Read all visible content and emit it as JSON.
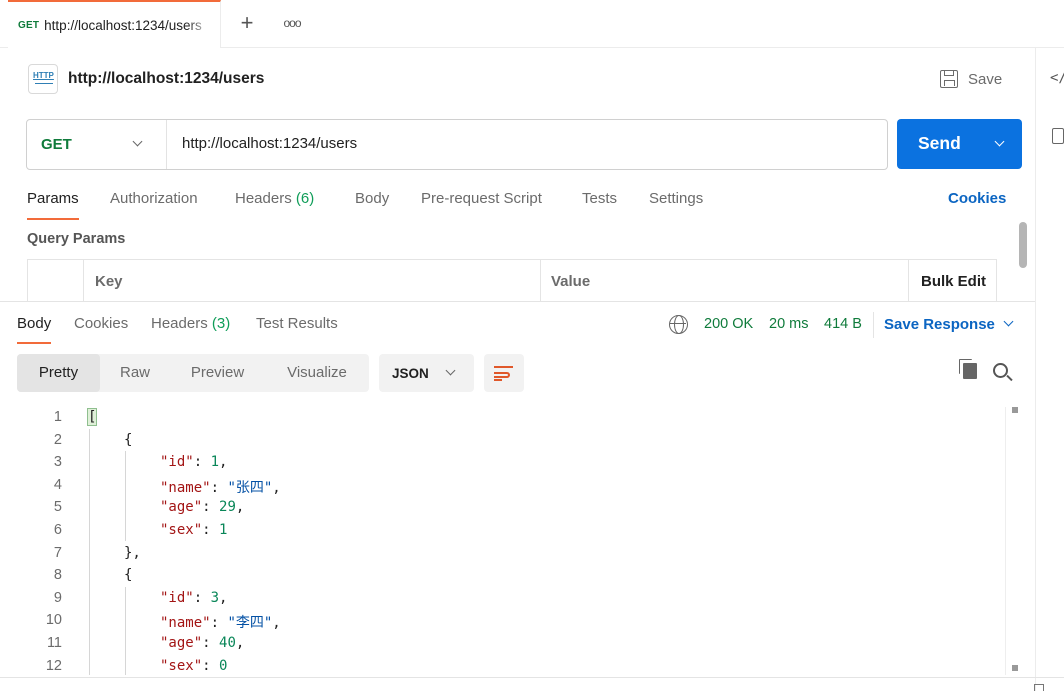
{
  "tabbar": {
    "tab_method": "GET",
    "tab_url": "http://localhost:1234/users",
    "new_tab": "+",
    "more": "ooo"
  },
  "sidebar_right": {
    "code_icon": "</"
  },
  "request": {
    "title": "http://localhost:1234/users",
    "save_label": "Save",
    "method": "GET",
    "url": "http://localhost:1234/users",
    "send_label": "Send"
  },
  "request_tabs": [
    {
      "label": "Params",
      "active": true
    },
    {
      "label": "Authorization"
    },
    {
      "label": "Headers",
      "count": "(6)"
    },
    {
      "label": "Body"
    },
    {
      "label": "Pre-request Script"
    },
    {
      "label": "Tests"
    },
    {
      "label": "Settings"
    }
  ],
  "cookies_label": "Cookies",
  "query_params": {
    "title": "Query Params",
    "columns": [
      "Key",
      "Value",
      "Bulk Edit"
    ]
  },
  "response": {
    "tabs": [
      {
        "label": "Body",
        "active": true
      },
      {
        "label": "Cookies"
      },
      {
        "label": "Headers",
        "count": "(3)"
      },
      {
        "label": "Test Results"
      }
    ],
    "status": "200 OK",
    "time": "20 ms",
    "size": "414 B",
    "save_response": "Save Response",
    "views": [
      "Pretty",
      "Raw",
      "Preview",
      "Visualize"
    ],
    "format": "JSON",
    "lines": [
      {
        "n": "1",
        "text": "["
      },
      {
        "n": "2",
        "text": "{"
      },
      {
        "n": "3",
        "key": "\"id\"",
        "val": "1",
        "type": "num",
        "comma": ","
      },
      {
        "n": "4",
        "key": "\"name\"",
        "val": "\"张四\"",
        "type": "str",
        "comma": ","
      },
      {
        "n": "5",
        "key": "\"age\"",
        "val": "29",
        "type": "num",
        "comma": ","
      },
      {
        "n": "6",
        "key": "\"sex\"",
        "val": "1",
        "type": "num",
        "comma": ""
      },
      {
        "n": "7",
        "text": "},"
      },
      {
        "n": "8",
        "text": "{"
      },
      {
        "n": "9",
        "key": "\"id\"",
        "val": "3",
        "type": "num",
        "comma": ","
      },
      {
        "n": "10",
        "key": "\"name\"",
        "val": "\"李四\"",
        "type": "str",
        "comma": ","
      },
      {
        "n": "11",
        "key": "\"age\"",
        "val": "40",
        "type": "num",
        "comma": ","
      },
      {
        "n": "12",
        "key": "\"sex\"",
        "val": "0",
        "type": "num",
        "comma": ""
      }
    ]
  },
  "colors": {
    "accent_orange": "#f26b3a",
    "send_blue": "#0b72e0",
    "method_green": "#0f7b3b",
    "link_blue": "#0b65c2"
  }
}
